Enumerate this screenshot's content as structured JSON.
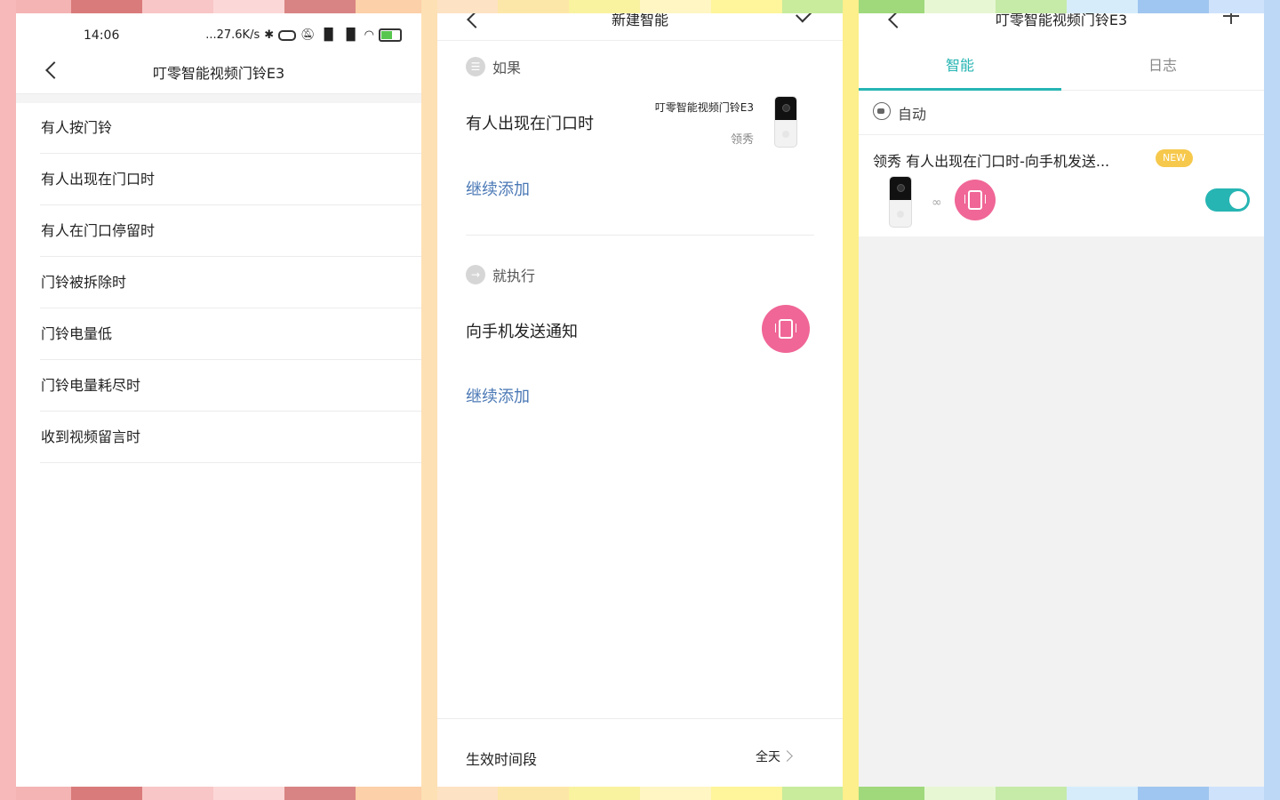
{
  "colors": {
    "accent": "#26b5b3",
    "link_blue": "#4a78b5",
    "pink": "#f06696",
    "badge_yellow": "#f6c84c"
  },
  "panel1": {
    "status": {
      "time": "14:06",
      "speed": "...27.6K/s"
    },
    "title": "叮零智能视频门铃E3",
    "triggers": [
      "有人按门铃",
      "有人出现在门口时",
      "有人在门口停留时",
      "门铃被拆除时",
      "门铃电量低",
      "门铃电量耗尽时",
      "收到视频留言时"
    ]
  },
  "panel2": {
    "title": "新建智能",
    "if_label": "如果",
    "condition": "有人出现在门口时",
    "device_name": "叮零智能视频门铃E3",
    "device_room": "领秀",
    "add_more_1": "继续添加",
    "then_label": "就执行",
    "action": "向手机发送通知",
    "add_more_2": "继续添加",
    "footer_label": "生效时间段",
    "footer_value": "全天"
  },
  "panel3": {
    "title": "叮零智能视频门铃E3",
    "tabs": [
      "智能",
      "日志"
    ],
    "auto_label": "自动",
    "rule_title": "领秀 有人出现在门口时-向手机发送...",
    "badge": "NEW",
    "toggle_on": true
  }
}
